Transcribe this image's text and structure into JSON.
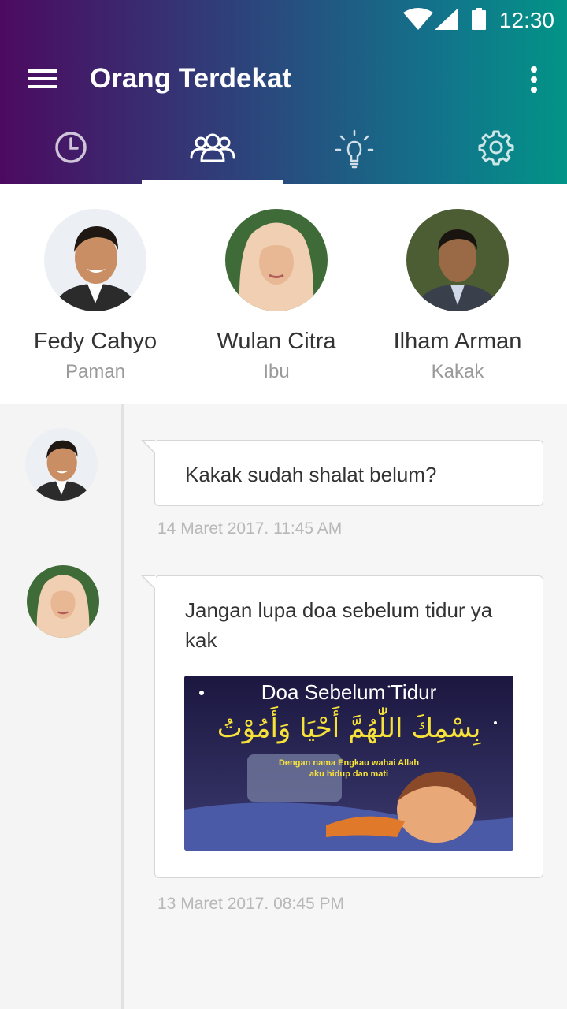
{
  "status_bar": {
    "time": "12:30"
  },
  "app_bar": {
    "title": "Orang Terdekat"
  },
  "tabs": [
    {
      "icon": "clock-icon"
    },
    {
      "icon": "people-icon",
      "active": true
    },
    {
      "icon": "lightbulb-icon"
    },
    {
      "icon": "gear-icon"
    }
  ],
  "contacts": [
    {
      "name": "Fedy Cahyo",
      "relation": "Paman"
    },
    {
      "name": "Wulan Citra",
      "relation": "Ibu"
    },
    {
      "name": "Ilham Arman",
      "relation": "Kakak"
    }
  ],
  "messages": [
    {
      "sender": "Fedy Cahyo",
      "text": "Kakak sudah shalat belum?",
      "timestamp": "14 Maret 2017. 11:45 AM"
    },
    {
      "sender": "Wulan Citra",
      "text": "Jangan lupa doa sebelum tidur ya kak",
      "timestamp": "13 Maret 2017.  08:45 PM",
      "image": {
        "title": "Doa Sebelum Tidur",
        "arabic": "بِسْمِكَ اللّٰهُمَّ أَحْيَا وَأَمُوْتُ",
        "caption_line1": "Dengan nama Engkau wahai Allah",
        "caption_line2": "aku hidup dan mati"
      }
    }
  ],
  "colors": {
    "header_start": "#4c0a60",
    "header_end": "#029488",
    "accent": "#ffffff"
  }
}
